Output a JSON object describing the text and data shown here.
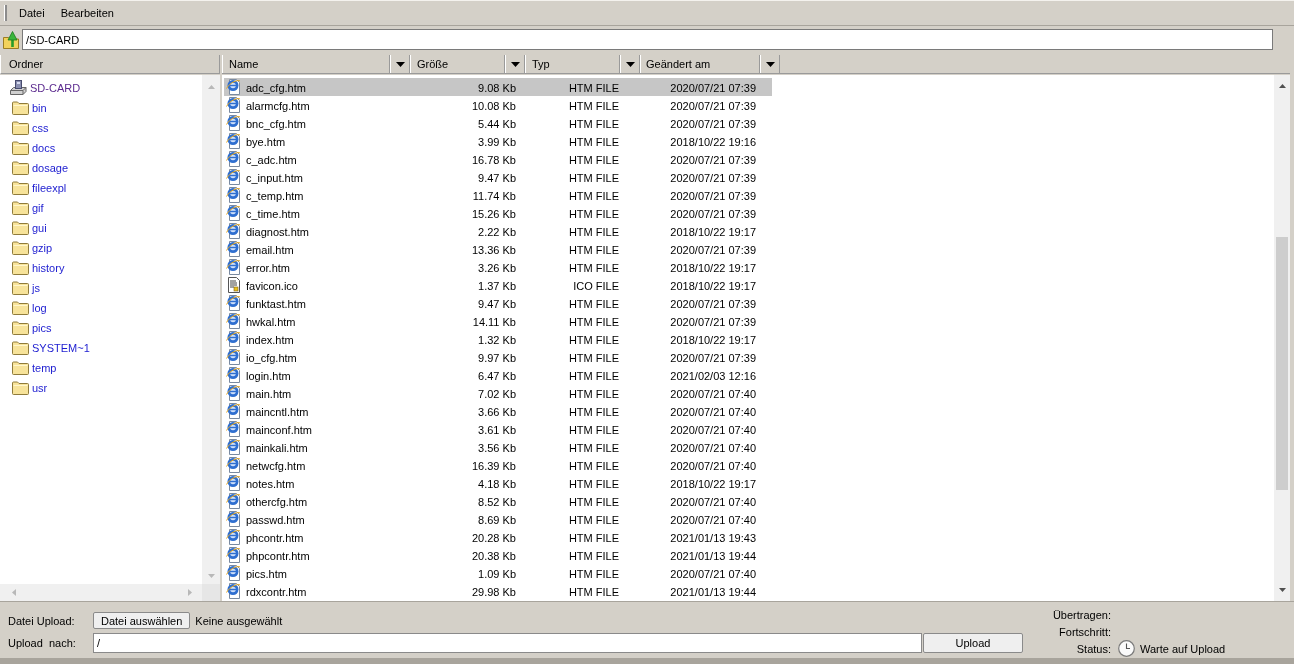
{
  "menu": [
    {
      "label": "Datei"
    },
    {
      "label": "Bearbeiten"
    }
  ],
  "address": {
    "value": "/SD-CARD"
  },
  "folder_pane": {
    "title": "Ordner",
    "tree": {
      "label": "SD-CARD",
      "selected": true,
      "children": [
        {
          "label": "bin",
          "selected": false
        },
        {
          "label": "css",
          "selected": false
        },
        {
          "label": "docs",
          "selected": false
        },
        {
          "label": "dosage",
          "selected": false
        },
        {
          "label": "fileexpl",
          "selected": false
        },
        {
          "label": "gif",
          "selected": false
        },
        {
          "label": "gui",
          "selected": false
        },
        {
          "label": "gzip",
          "selected": false
        },
        {
          "label": "history",
          "selected": false
        },
        {
          "label": "js",
          "selected": false
        },
        {
          "label": "log",
          "selected": false
        },
        {
          "label": "pics",
          "selected": false
        },
        {
          "label": "SYSTEM~1",
          "selected": false
        },
        {
          "label": "temp",
          "selected": false
        },
        {
          "label": "usr",
          "selected": false
        }
      ]
    }
  },
  "file_list": {
    "columns": [
      {
        "label": "Name"
      },
      {
        "label": "Größe"
      },
      {
        "label": "Typ"
      },
      {
        "label": "Geändert am"
      }
    ],
    "rows": [
      {
        "kind": "html",
        "name": "adc_cfg.htm",
        "size": "9.08 Kb",
        "type": "HTM FILE",
        "modified": "2020/07/21 07:39",
        "selected": true
      },
      {
        "kind": "html",
        "name": "alarmcfg.htm",
        "size": "10.08 Kb",
        "type": "HTM FILE",
        "modified": "2020/07/21 07:39",
        "selected": false
      },
      {
        "kind": "html",
        "name": "bnc_cfg.htm",
        "size": "5.44 Kb",
        "type": "HTM FILE",
        "modified": "2020/07/21 07:39",
        "selected": false
      },
      {
        "kind": "html",
        "name": "bye.htm",
        "size": "3.99 Kb",
        "type": "HTM FILE",
        "modified": "2018/10/22 19:16",
        "selected": false
      },
      {
        "kind": "html",
        "name": "c_adc.htm",
        "size": "16.78 Kb",
        "type": "HTM FILE",
        "modified": "2020/07/21 07:39",
        "selected": false
      },
      {
        "kind": "html",
        "name": "c_input.htm",
        "size": "9.47 Kb",
        "type": "HTM FILE",
        "modified": "2020/07/21 07:39",
        "selected": false
      },
      {
        "kind": "html",
        "name": "c_temp.htm",
        "size": "11.74 Kb",
        "type": "HTM FILE",
        "modified": "2020/07/21 07:39",
        "selected": false
      },
      {
        "kind": "html",
        "name": "c_time.htm",
        "size": "15.26 Kb",
        "type": "HTM FILE",
        "modified": "2020/07/21 07:39",
        "selected": false
      },
      {
        "kind": "html",
        "name": "diagnost.htm",
        "size": "2.22 Kb",
        "type": "HTM FILE",
        "modified": "2018/10/22 19:17",
        "selected": false
      },
      {
        "kind": "html",
        "name": "email.htm",
        "size": "13.36 Kb",
        "type": "HTM FILE",
        "modified": "2020/07/21 07:39",
        "selected": false
      },
      {
        "kind": "html",
        "name": "error.htm",
        "size": "3.26 Kb",
        "type": "HTM FILE",
        "modified": "2018/10/22 19:17",
        "selected": false
      },
      {
        "kind": "ico",
        "name": "favicon.ico",
        "size": "1.37 Kb",
        "type": "ICO FILE",
        "modified": "2018/10/22 19:17",
        "selected": false
      },
      {
        "kind": "html",
        "name": "funktast.htm",
        "size": "9.47 Kb",
        "type": "HTM FILE",
        "modified": "2020/07/21 07:39",
        "selected": false
      },
      {
        "kind": "html",
        "name": "hwkal.htm",
        "size": "14.11 Kb",
        "type": "HTM FILE",
        "modified": "2020/07/21 07:39",
        "selected": false
      },
      {
        "kind": "html",
        "name": "index.htm",
        "size": "1.32 Kb",
        "type": "HTM FILE",
        "modified": "2018/10/22 19:17",
        "selected": false
      },
      {
        "kind": "html",
        "name": "io_cfg.htm",
        "size": "9.97 Kb",
        "type": "HTM FILE",
        "modified": "2020/07/21 07:39",
        "selected": false
      },
      {
        "kind": "html",
        "name": "login.htm",
        "size": "6.47 Kb",
        "type": "HTM FILE",
        "modified": "2021/02/03 12:16",
        "selected": false
      },
      {
        "kind": "html",
        "name": "main.htm",
        "size": "7.02 Kb",
        "type": "HTM FILE",
        "modified": "2020/07/21 07:40",
        "selected": false
      },
      {
        "kind": "html",
        "name": "maincntl.htm",
        "size": "3.66 Kb",
        "type": "HTM FILE",
        "modified": "2020/07/21 07:40",
        "selected": false
      },
      {
        "kind": "html",
        "name": "mainconf.htm",
        "size": "3.61 Kb",
        "type": "HTM FILE",
        "modified": "2020/07/21 07:40",
        "selected": false
      },
      {
        "kind": "html",
        "name": "mainkali.htm",
        "size": "3.56 Kb",
        "type": "HTM FILE",
        "modified": "2020/07/21 07:40",
        "selected": false
      },
      {
        "kind": "html",
        "name": "netwcfg.htm",
        "size": "16.39 Kb",
        "type": "HTM FILE",
        "modified": "2020/07/21 07:40",
        "selected": false
      },
      {
        "kind": "html",
        "name": "notes.htm",
        "size": "4.18 Kb",
        "type": "HTM FILE",
        "modified": "2018/10/22 19:17",
        "selected": false
      },
      {
        "kind": "html",
        "name": "othercfg.htm",
        "size": "8.52 Kb",
        "type": "HTM FILE",
        "modified": "2020/07/21 07:40",
        "selected": false
      },
      {
        "kind": "html",
        "name": "passwd.htm",
        "size": "8.69 Kb",
        "type": "HTM FILE",
        "modified": "2020/07/21 07:40",
        "selected": false
      },
      {
        "kind": "html",
        "name": "phcontr.htm",
        "size": "20.28 Kb",
        "type": "HTM FILE",
        "modified": "2021/01/13 19:43",
        "selected": false
      },
      {
        "kind": "html",
        "name": "phpcontr.htm",
        "size": "20.38 Kb",
        "type": "HTM FILE",
        "modified": "2021/01/13 19:44",
        "selected": false
      },
      {
        "kind": "html",
        "name": "pics.htm",
        "size": "1.09 Kb",
        "type": "HTM FILE",
        "modified": "2020/07/21 07:40",
        "selected": false
      },
      {
        "kind": "html",
        "name": "rdxcontr.htm",
        "size": "29.98 Kb",
        "type": "HTM FILE",
        "modified": "2021/01/13 19:44",
        "selected": false
      }
    ]
  },
  "upload": {
    "file_label": "Datei Upload:",
    "choose_button": "Datei auswählen",
    "file_status": "Keine ausgewählt",
    "target_label": "Upload  nach:",
    "target_value": "/",
    "upload_button": "Upload"
  },
  "status": {
    "transferred_label": "Übertragen:",
    "progress_label": "Fortschritt:",
    "status_label": "Status:",
    "status_text": "Warte auf Upload"
  }
}
